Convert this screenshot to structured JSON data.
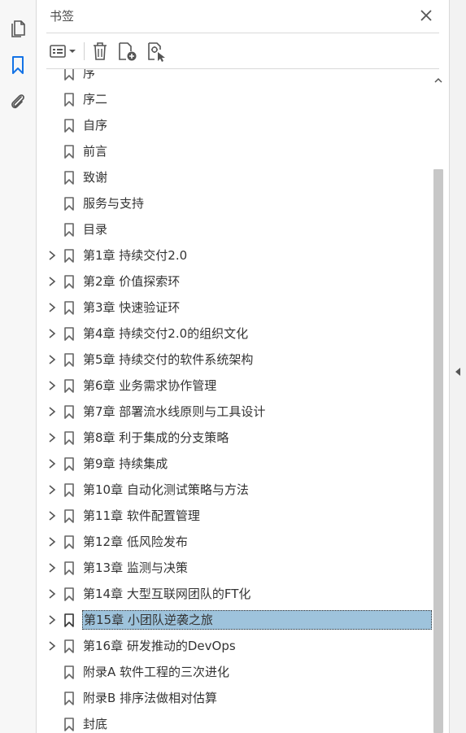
{
  "panel": {
    "title": "书签"
  },
  "toolbar": {
    "icons": [
      "bookmark-options-icon",
      "delete-icon",
      "new-bookmark-icon",
      "new-bookmark-from-structure-icon"
    ]
  },
  "bookmarks": [
    {
      "label": "序",
      "expandable": false,
      "selected": false
    },
    {
      "label": "序二",
      "expandable": false,
      "selected": false
    },
    {
      "label": "自序",
      "expandable": false,
      "selected": false
    },
    {
      "label": "前言",
      "expandable": false,
      "selected": false
    },
    {
      "label": "致谢",
      "expandable": false,
      "selected": false
    },
    {
      "label": "服务与支持",
      "expandable": false,
      "selected": false
    },
    {
      "label": "目录",
      "expandable": false,
      "selected": false
    },
    {
      "label": "第1章 持续交付2.0",
      "expandable": true,
      "selected": false
    },
    {
      "label": "第2章 价值探索环",
      "expandable": true,
      "selected": false
    },
    {
      "label": "第3章 快速验证环",
      "expandable": true,
      "selected": false
    },
    {
      "label": "第4章 持续交付2.0的组织文化",
      "expandable": true,
      "selected": false
    },
    {
      "label": "第5章 持续交付的软件系统架构",
      "expandable": true,
      "selected": false
    },
    {
      "label": "第6章 业务需求协作管理",
      "expandable": true,
      "selected": false
    },
    {
      "label": "第7章 部署流水线原则与工具设计",
      "expandable": true,
      "selected": false
    },
    {
      "label": "第8章 利于集成的分支策略",
      "expandable": true,
      "selected": false
    },
    {
      "label": "第9章 持续集成",
      "expandable": true,
      "selected": false
    },
    {
      "label": "第10章 自动化测试策略与方法",
      "expandable": true,
      "selected": false
    },
    {
      "label": "第11章 软件配置管理",
      "expandable": true,
      "selected": false
    },
    {
      "label": "第12章 低风险发布",
      "expandable": true,
      "selected": false
    },
    {
      "label": "第13章 监测与决策",
      "expandable": true,
      "selected": false
    },
    {
      "label": "第14章 大型互联网团队的FT化",
      "expandable": true,
      "selected": false
    },
    {
      "label": "第15章 小团队逆袭之旅",
      "expandable": true,
      "selected": true
    },
    {
      "label": "第16章 研发推动的DevOps",
      "expandable": true,
      "selected": false
    },
    {
      "label": "附录A 软件工程的三次进化",
      "expandable": false,
      "selected": false
    },
    {
      "label": "附录B 排序法做相对估算",
      "expandable": false,
      "selected": false
    },
    {
      "label": "封底",
      "expandable": false,
      "selected": false
    }
  ],
  "colors": {
    "selection": "#9ec3dc",
    "accent": "#1473e6",
    "icon": "#555555"
  }
}
